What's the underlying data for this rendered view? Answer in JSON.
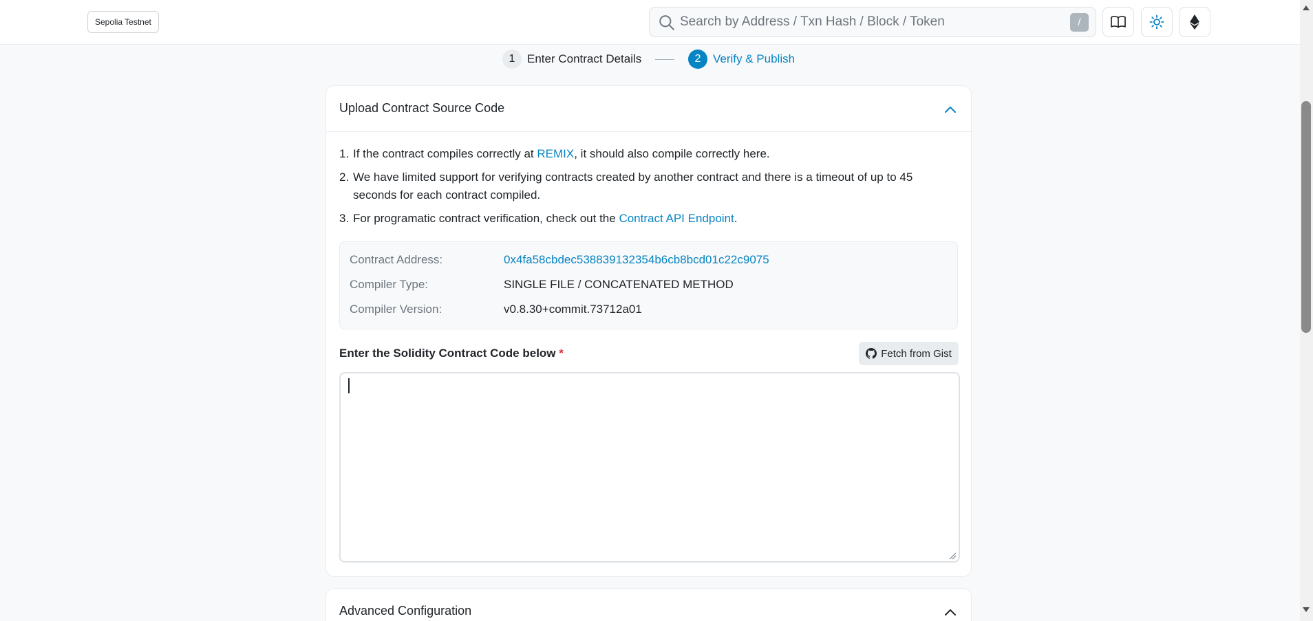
{
  "header": {
    "network": "Sepolia Testnet",
    "search_placeholder": "Search by Address / Txn Hash / Block / Token",
    "search_shortcut": "/"
  },
  "stepper": {
    "steps": [
      {
        "num": "1",
        "label": "Enter Contract Details"
      },
      {
        "num": "2",
        "label": "Verify & Publish"
      }
    ]
  },
  "upload_card": {
    "title": "Upload Contract Source Code",
    "notes": [
      {
        "num": "1.",
        "pre": "If the contract compiles correctly at ",
        "link": "REMIX",
        "post": ", it should also compile correctly here."
      },
      {
        "num": "2.",
        "text": "We have limited support for verifying contracts created by another contract and there is a timeout of up to 45 seconds for each contract compiled."
      },
      {
        "num": "3.",
        "pre": "For programatic contract verification, check out the ",
        "link": "Contract API Endpoint",
        "post": "."
      }
    ],
    "info": {
      "address_label": "Contract Address:",
      "address_value": "0x4fa58cbdec538839132354b6cb8bcd01c22c9075",
      "compiler_type_label": "Compiler Type:",
      "compiler_type_value": "SINGLE FILE / CONCATENATED METHOD",
      "compiler_version_label": "Compiler Version:",
      "compiler_version_value": "v0.8.30+commit.73712a01"
    },
    "code_label": "Enter the Solidity Contract Code below",
    "required_mark": "*",
    "gist_button": "Fetch from Gist",
    "code_value": ""
  },
  "advanced_card": {
    "title": "Advanced Configuration"
  },
  "colors": {
    "accent": "#0784c3",
    "required": "#dc3545"
  }
}
